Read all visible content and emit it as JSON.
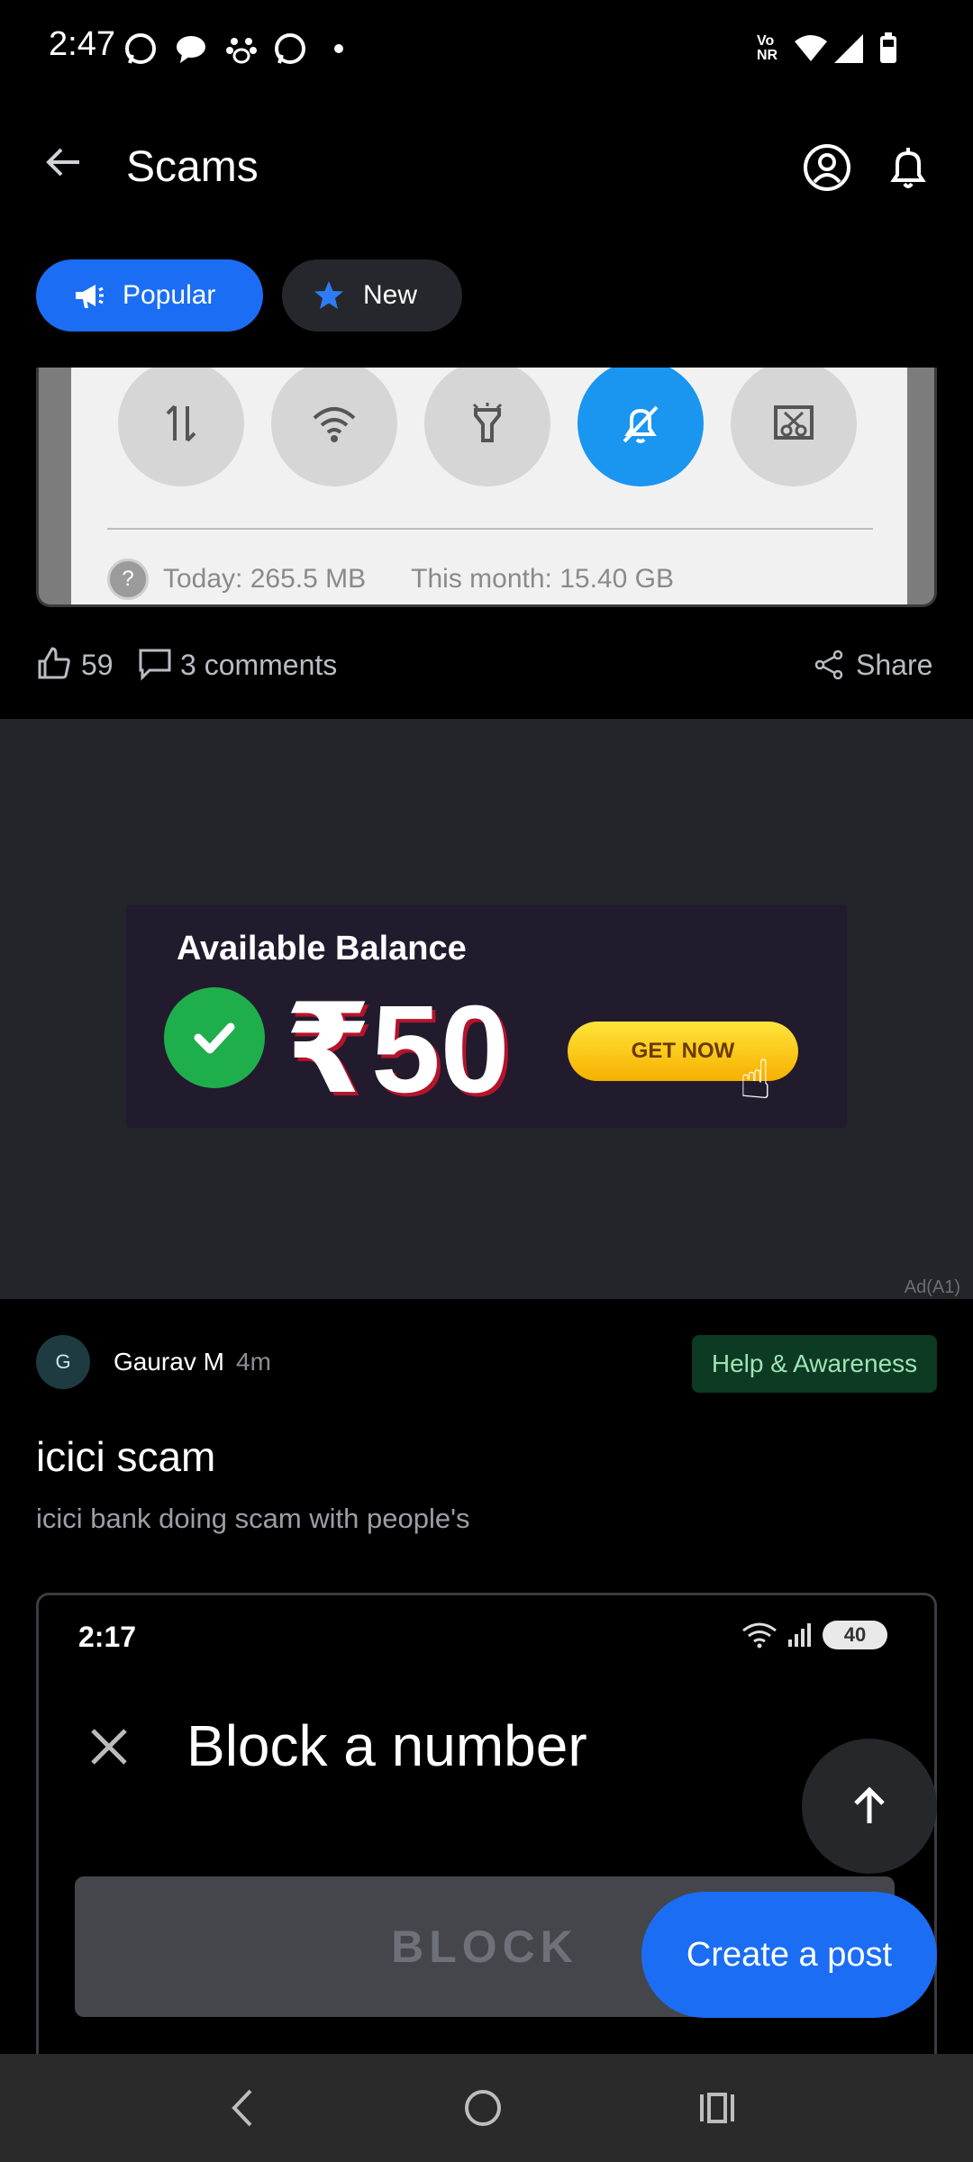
{
  "status_bar": {
    "time": "2:47",
    "notification_icons": [
      "whatsapp-icon",
      "chat-icon",
      "paw-icon",
      "whatsapp-icon",
      "dot-icon"
    ],
    "system_icons": [
      "volte-icon",
      "wifi-icon",
      "signal-icon",
      "battery-icon"
    ],
    "volte_text": "Vo\nNR"
  },
  "header": {
    "title": "Scams"
  },
  "filters": {
    "popular": "Popular",
    "new": "New"
  },
  "post1": {
    "usage_today": "Today: 265.5 MB",
    "usage_month": "This month: 15.40 GB",
    "help": "?",
    "likes": "59",
    "comments": "3 comments",
    "share": "Share"
  },
  "ad": {
    "title": "Available Balance",
    "amount": "₹50",
    "cta": "GET NOW",
    "label": "Ad(A1)"
  },
  "post2": {
    "avatar_initial": "G",
    "author": "Gaurav M",
    "time": "4m",
    "category": "Help & Awareness",
    "title": "icici scam",
    "body": "icici bank doing scam with people's",
    "screenshot": {
      "time": "2:17",
      "battery": "40",
      "heading": "Block a number",
      "block_button": "BLOCK"
    }
  },
  "floating": {
    "create_post": "Create a post"
  },
  "colors": {
    "accent": "#1b6ef3",
    "background": "#000000",
    "badge_bg": "#0c3a22",
    "badge_text": "#9ee3b5"
  }
}
